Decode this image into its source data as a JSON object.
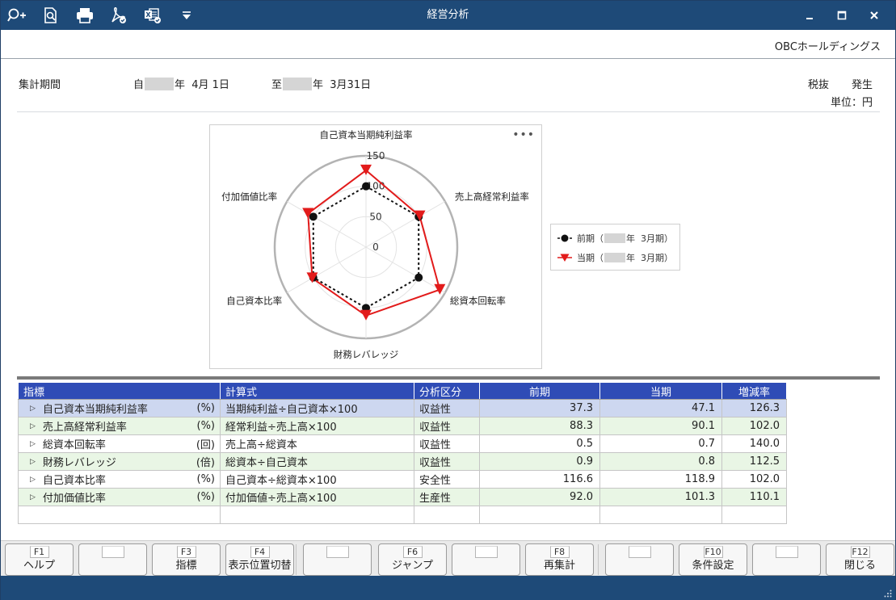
{
  "window": {
    "title": "経営分析",
    "company": "OBCホールディングス"
  },
  "toolbar": {
    "icons": [
      "zoom-in-icon",
      "zoom-page-icon",
      "print-icon",
      "pdf-icon",
      "excel-icon",
      "dropdown-icon"
    ]
  },
  "header": {
    "period_label": "集計期間",
    "from_prefix": "自",
    "from_suffix": "年  4月 1日",
    "to_prefix": "至",
    "to_suffix": "年  3月31日",
    "tax": "税抜",
    "basis": "発生",
    "unit": "単位：円"
  },
  "legend": {
    "prev_prefix": "前期（",
    "prev_suffix": "年  3月期）",
    "curr_prefix": "当期（",
    "curr_suffix": "年  3月期）"
  },
  "chart_data": {
    "type": "radar",
    "axes": [
      "自己資本当期純利益率",
      "売上高経常利益率",
      "総資本回転率",
      "財務レバレッジ",
      "自己資本比率",
      "付加価値比率"
    ],
    "ticks": [
      "0",
      "50",
      "100",
      "150"
    ],
    "rlim": [
      0,
      150
    ],
    "series": [
      {
        "name": "前期",
        "values": [
          100,
          100,
          100,
          100,
          100,
          100
        ],
        "color": "#111111",
        "marker": "circle",
        "line": "dashed"
      },
      {
        "name": "当期",
        "values": [
          126.3,
          102.0,
          140.0,
          112.5,
          102.0,
          110.1
        ],
        "color": "#e21b1b",
        "marker": "triangle-down",
        "line": "solid"
      }
    ]
  },
  "table": {
    "headers": [
      "指標",
      "計算式",
      "分析区分",
      "前期",
      "当期",
      "増減率"
    ],
    "rows": [
      {
        "name": "自己資本当期純利益率",
        "unit": "(%)",
        "formula": "当期純利益÷自己資本×100",
        "category": "収益性",
        "prev": "37.3",
        "curr": "47.1",
        "rate": "126.3"
      },
      {
        "name": "売上高経常利益率",
        "unit": "(%)",
        "formula": "経常利益÷売上高×100",
        "category": "収益性",
        "prev": "88.3",
        "curr": "90.1",
        "rate": "102.0"
      },
      {
        "name": "総資本回転率",
        "unit": "(回)",
        "formula": "売上高÷総資本",
        "category": "収益性",
        "prev": "0.5",
        "curr": "0.7",
        "rate": "140.0"
      },
      {
        "name": "財務レバレッジ",
        "unit": "(倍)",
        "formula": "総資本÷自己資本",
        "category": "収益性",
        "prev": "0.9",
        "curr": "0.8",
        "rate": "112.5"
      },
      {
        "name": "自己資本比率",
        "unit": "(%)",
        "formula": "自己資本÷総資本×100",
        "category": "安全性",
        "prev": "116.6",
        "curr": "118.9",
        "rate": "102.0"
      },
      {
        "name": "付加価値比率",
        "unit": "(%)",
        "formula": "付加価値÷売上高×100",
        "category": "生産性",
        "prev": "92.0",
        "curr": "101.3",
        "rate": "110.1"
      }
    ]
  },
  "fkeys": [
    {
      "key": "F1",
      "label": "ヘルプ"
    },
    {
      "key": "",
      "label": ""
    },
    {
      "key": "F3",
      "label": "指標"
    },
    {
      "key": "F4",
      "label": "表示位置切替"
    },
    {
      "key": "",
      "label": ""
    },
    {
      "key": "F6",
      "label": "ジャンプ"
    },
    {
      "key": "",
      "label": ""
    },
    {
      "key": "F8",
      "label": "再集計"
    },
    {
      "key": "",
      "label": ""
    },
    {
      "key": "F10",
      "label": "条件設定"
    },
    {
      "key": "",
      "label": ""
    },
    {
      "key": "F12",
      "label": "閉じる"
    }
  ]
}
